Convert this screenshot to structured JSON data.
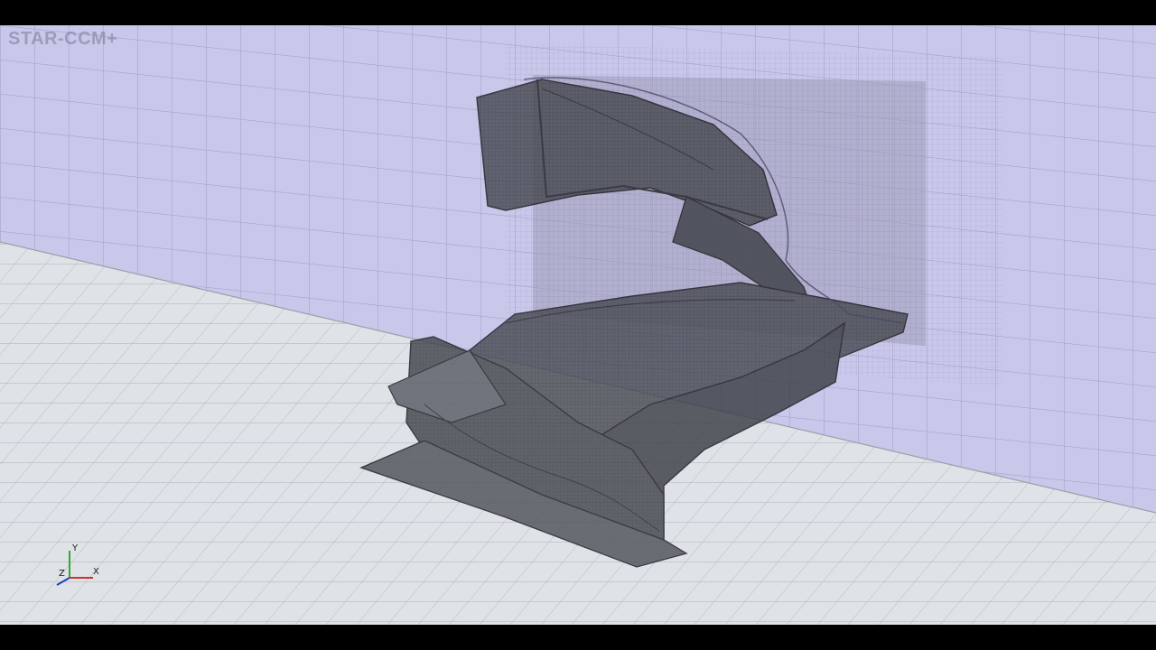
{
  "app": {
    "logo_text": "STAR-CCM+"
  },
  "triad": {
    "x_label": "X",
    "y_label": "Y",
    "z_label": "Z",
    "x_color": "#d03030",
    "y_color": "#2faa2f",
    "z_color": "#2040c0"
  },
  "scene": {
    "wall_color": "#c9c7ea",
    "floor_color": "#dfe2e6",
    "body_color": "#3a3d44",
    "mesh_line_color": "#8a8fa3"
  }
}
